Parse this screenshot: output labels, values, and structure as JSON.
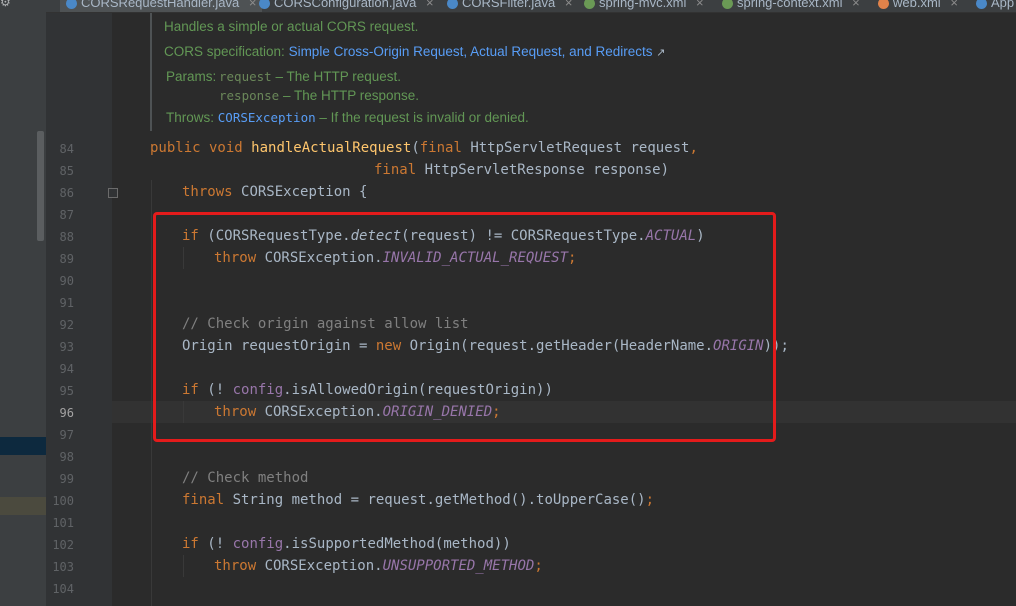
{
  "tabs": [
    {
      "label": "CORSRequestHandler.java",
      "active": true,
      "icon": "java-class-icon",
      "color": "#4a88c7"
    },
    {
      "label": "CORSConfiguration.java",
      "active": false,
      "icon": "java-class-icon",
      "color": "#4a88c7"
    },
    {
      "label": "CORSFilter.java",
      "active": false,
      "icon": "java-class-icon",
      "color": "#4a88c7"
    },
    {
      "label": "spring-mvc.xml",
      "active": false,
      "icon": "spring-xml-icon",
      "color": "#6a9955"
    },
    {
      "label": "spring-context.xml",
      "active": false,
      "icon": "spring-xml-icon",
      "color": "#6a9955"
    },
    {
      "label": "web.xml",
      "active": false,
      "icon": "xml-icon",
      "color": "#e0824a"
    },
    {
      "label": "App",
      "active": false,
      "icon": "java-class-icon",
      "color": "#4a88c7"
    }
  ],
  "doc": {
    "summary": "Handles a simple or actual CORS request.",
    "spec_label": "CORS specification:",
    "spec_link": "Simple Cross-Origin Request, Actual Request, and Redirects",
    "params_label": "Params:",
    "param1_name": "request",
    "param1_desc": " – The HTTP request.",
    "param2_name": "response",
    "param2_desc": " – The HTTP response.",
    "throws_label": "Throws:",
    "throws_type": "CORSException",
    "throws_desc": " – If the request is invalid or denied."
  },
  "line_numbers": [
    "84",
    "85",
    "86",
    "87",
    "88",
    "89",
    "90",
    "91",
    "92",
    "93",
    "94",
    "95",
    "96",
    "97",
    "98",
    "99",
    "100",
    "101",
    "102",
    "103",
    "104"
  ],
  "current_line": "96",
  "code": {
    "l84_kw1": "public void ",
    "l84_fn": "handleActualRequest",
    "l84_a": "(",
    "l84_kw2": "final ",
    "l84_b": "HttpServletRequest request",
    "l84_c": ",",
    "l85_kw": "final ",
    "l85_b": "HttpServletResponse response)",
    "l86_kw": "throws ",
    "l86_b": "CORSException {",
    "l88_kw": "if ",
    "l88_a": "(CORSRequestType.",
    "l88_it": "detect",
    "l88_b": "(request) != CORSRequestType.",
    "l88_c": "ACTUAL",
    "l88_d": ")",
    "l89_kw": "throw ",
    "l89_a": "CORSException.",
    "l89_c": "INVALID_ACTUAL_REQUEST",
    "l89_d": ";",
    "l92_cm": "// Check origin against allow list",
    "l93_a": "Origin requestOrigin = ",
    "l93_kw": "new ",
    "l93_b": "Origin(request.getHeader(HeaderName.",
    "l93_c": "ORIGIN",
    "l93_d": "));",
    "l95_kw": "if ",
    "l95_a": "(! ",
    "l95_f": "config",
    "l95_b": ".isAllowedOrigin(requestOrigin))",
    "l96_kw": "throw ",
    "l96_a": "CORSException.",
    "l96_c": "ORIGIN_DENIED",
    "l96_d": ";",
    "l99_cm": "// Check method",
    "l100_kw": "final ",
    "l100_a": "String method = request.getMethod().toUpperCase()",
    "l100_d": ";",
    "l102_kw": "if ",
    "l102_a": "(! ",
    "l102_f": "config",
    "l102_b": ".isSupportedMethod(method))",
    "l103_kw": "throw ",
    "l103_a": "CORSException.",
    "l103_c": "UNSUPPORTED_METHOD",
    "l103_d": ";"
  },
  "colors": {
    "keyword": "#cc7832",
    "method": "#ffc66d",
    "constant": "#9876aa",
    "comment": "#808080",
    "doc": "#629755",
    "highlight_box": "#e41b1b"
  }
}
